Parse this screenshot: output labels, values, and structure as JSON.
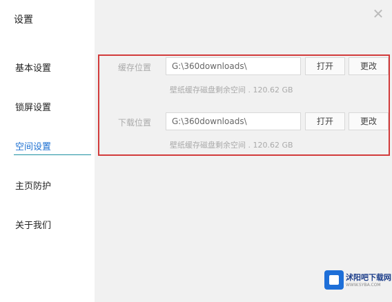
{
  "sidebar": {
    "title": "设置",
    "items": [
      {
        "label": "基本设置"
      },
      {
        "label": "锁屏设置"
      },
      {
        "label": "空间设置",
        "active": true
      },
      {
        "label": "主页防护"
      },
      {
        "label": "关于我们"
      }
    ]
  },
  "close_icon": "close-icon",
  "storage": {
    "cache": {
      "label": "缓存位置",
      "path": "G:\\360downloads\\",
      "open_label": "打开",
      "change_label": "更改",
      "note": "壁纸缓存磁盘剩余空间 . 120.62  GB"
    },
    "download": {
      "label": "下载位置",
      "path": "G:\\360downloads\\",
      "open_label": "打开",
      "change_label": "更改",
      "note": "壁纸缓存磁盘剩余空间 . 120.62  GB"
    }
  },
  "watermark": {
    "brand": "沭阳吧下载网",
    "url": "WWW.SYBA.COM"
  },
  "colors": {
    "highlight_border": "#d23a3a",
    "active_nav": "#1b6fd1",
    "logo_blue": "#1e6fd8"
  }
}
